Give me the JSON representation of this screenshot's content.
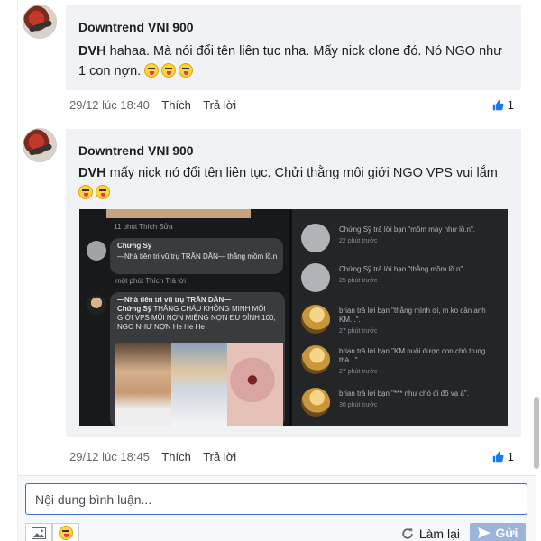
{
  "comments": [
    {
      "author": "Downtrend VNI 900",
      "user_tag": "DVH",
      "text": "hahaa. Mà nói đổi tên liên tục nha. Mấy nick clone đó. Nó NGO như 1 con nợn.",
      "emoji_count": 3,
      "timestamp": "29/12 lúc 18:40",
      "like_label": "Thích",
      "reply_label": "Trả lời",
      "likes": "1"
    },
    {
      "author": "Downtrend VNI 900",
      "user_tag": "DVH",
      "text": "mấy nick nó đổi tên liên tục. Chửi thằng môi giới NGO VPS vui lắm",
      "emoji_count": 2,
      "timestamp": "29/12 lúc 18:45",
      "like_label": "Thích",
      "reply_label": "Trả lời",
      "likes": "1"
    }
  ],
  "embedded": {
    "left": {
      "top_meta": "11 phút   Thích   Sửa",
      "c1_name": "Chứng Sỹ",
      "c1_text": "—Nhà tiên tri vũ trụ TRẦN DẦN— thằng mồm lồ.n",
      "c1_meta": "một phút   Thích   Trả lời",
      "c2_header": "—Nhà tiên tri vũ trụ TRẦN DẦN—",
      "c2_name": "Chứng Sỹ",
      "c2_text": "THẰNG CHÁU KHÔNG MINH MÔI GIỚI VPS MŨI NỢN MIỆNG NỢN ĐU ĐỈNH 100, NGO NHƯ NỢN He He He"
    },
    "right": [
      {
        "text": "Chứng Sỹ trả lời bạn \"mồm mày như lồ.n\".",
        "time": "22 phút trước",
        "avatar": "gray"
      },
      {
        "text": "Chứng Sỹ trả lời bạn \"thằng mồm lồ.n\".",
        "time": "25 phút trước",
        "avatar": "gray"
      },
      {
        "text": "brian trả lời bạn \"thằng mình ơi, m ko cần anh KM...\".",
        "time": "27 phút trước",
        "avatar": "bird"
      },
      {
        "text": "brian trả lời bạn \"KM nuôi được con chó trung thà...\".",
        "time": "27 phút trước",
        "avatar": "bird"
      },
      {
        "text": "brian trả lời bạn \"*** như chó đi đổ vạ à\".",
        "time": "30 phút trước",
        "avatar": "bird"
      }
    ]
  },
  "composer": {
    "placeholder": "Nội dung bình luận...",
    "reload_label": "Làm lại",
    "send_label": "Gửi"
  },
  "colors": {
    "accent": "#3a6fd8",
    "like_blue": "#1877f2",
    "bubble_bg": "#f0f2f5",
    "send_bg": "#9cb4d8"
  }
}
